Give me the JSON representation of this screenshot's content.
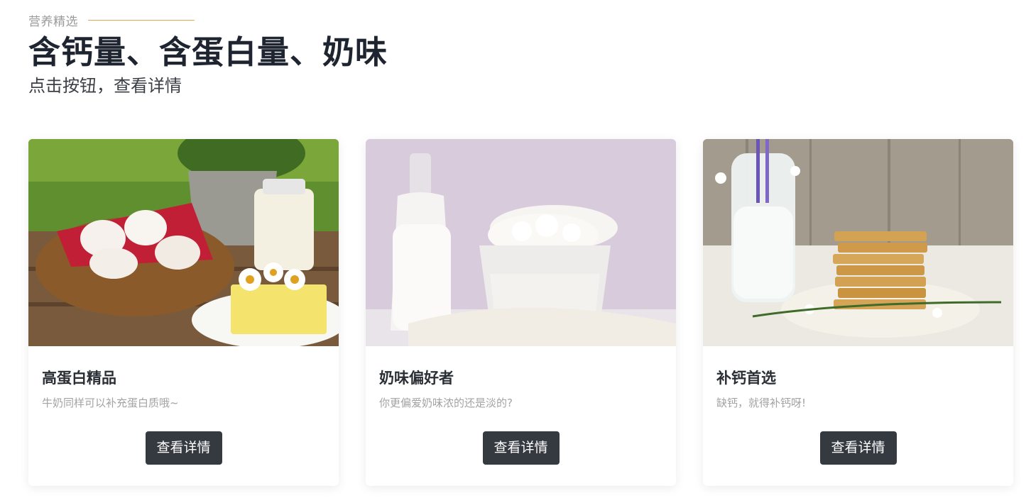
{
  "header": {
    "eyebrow": "营养精选",
    "title": "含钙量、含蛋白量、奶味",
    "subtitle": "点击按钮，查看详情"
  },
  "cards": [
    {
      "title": "高蛋白精品",
      "description": "牛奶同样可以补充蛋白质哦~",
      "button_label": "查看详情",
      "image": "eggs-milk-butter-photo"
    },
    {
      "title": "奶味偏好者",
      "description": "你更偏爱奶味浓的还是淡的?",
      "button_label": "查看详情",
      "image": "milk-bottle-cottage-cheese-photo"
    },
    {
      "title": "补钙首选",
      "description": "缺钙，就得补钙呀!",
      "button_label": "查看详情",
      "image": "milk-jar-crackers-photo"
    }
  ],
  "colors": {
    "accent_line": "#e0a95a",
    "button_bg": "#353a40",
    "title_text": "#1f2530"
  }
}
